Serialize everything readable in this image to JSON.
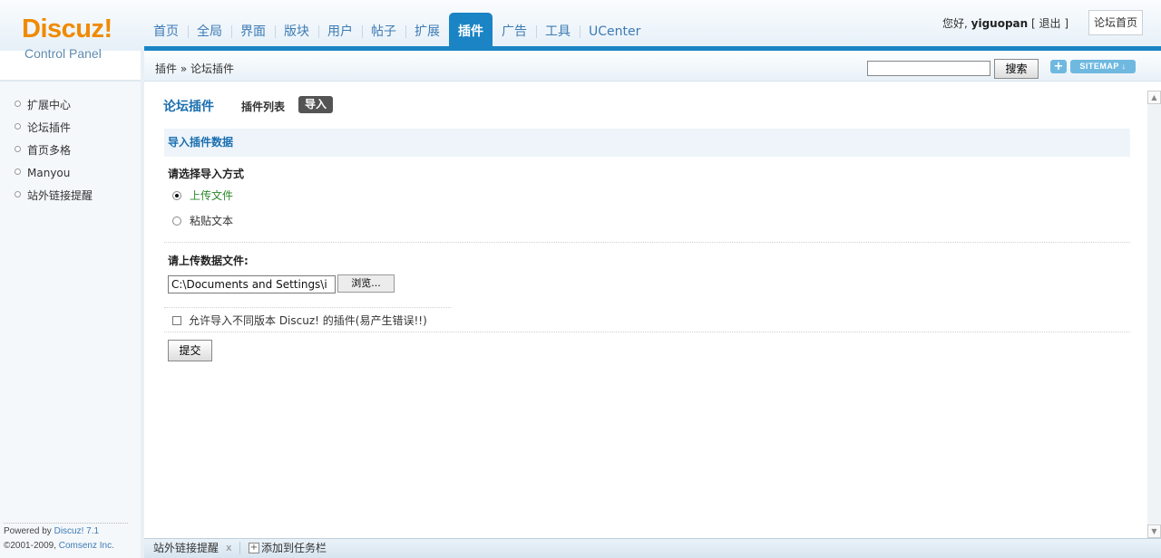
{
  "logo": {
    "title": "Discuz!",
    "subtitle": "Control Panel"
  },
  "nav": {
    "items": [
      "首页",
      "全局",
      "界面",
      "版块",
      "用户",
      "帖子",
      "扩展",
      "插件",
      "广告",
      "工具",
      "UCenter"
    ],
    "active": "插件"
  },
  "user": {
    "greeting": "您好,",
    "name": "yiguopan",
    "logout": "退出",
    "home": "论坛首页"
  },
  "breadcrumb": {
    "text": "插件 » 论坛插件"
  },
  "search": {
    "button": "搜索",
    "value": ""
  },
  "quick": {
    "plus": "+",
    "sitemap": "SITEMAP ↓"
  },
  "sidebar": {
    "items": [
      {
        "label": "扩展中心"
      },
      {
        "label": "论坛插件"
      },
      {
        "label": "首页多格"
      },
      {
        "label": "Manyou"
      },
      {
        "label": "站外链接提醒"
      }
    ]
  },
  "footer": {
    "powered_prefix": "Powered by ",
    "powered_link": "Discuz! 7.1",
    "copyright_prefix": "©2001-2009, ",
    "copyright_link": "Comsenz Inc."
  },
  "main": {
    "title": "论坛插件",
    "tab_list": "插件列表",
    "tab_import": "导入",
    "section_title": "导入插件数据",
    "method_label": "请选择导入方式",
    "radio_upload": "上传文件",
    "radio_paste": "粘贴文本",
    "upload_label": "请上传数据文件:",
    "file_value": "C:\\Documents and Settings\\i",
    "browse": "浏览...",
    "allow_label": "允许导入不同版本 Discuz! 的插件(易产生错误!!)",
    "submit": "提交"
  },
  "taskbar": {
    "item": "站外链接提醒",
    "close": "x",
    "add_icon": "+",
    "add": "添加到任务栏"
  },
  "colors": {
    "accent": "#1a84c5",
    "logo": "#f08a00",
    "link": "#3d7bb4",
    "radio_checked_text": "#2b8a2b"
  }
}
